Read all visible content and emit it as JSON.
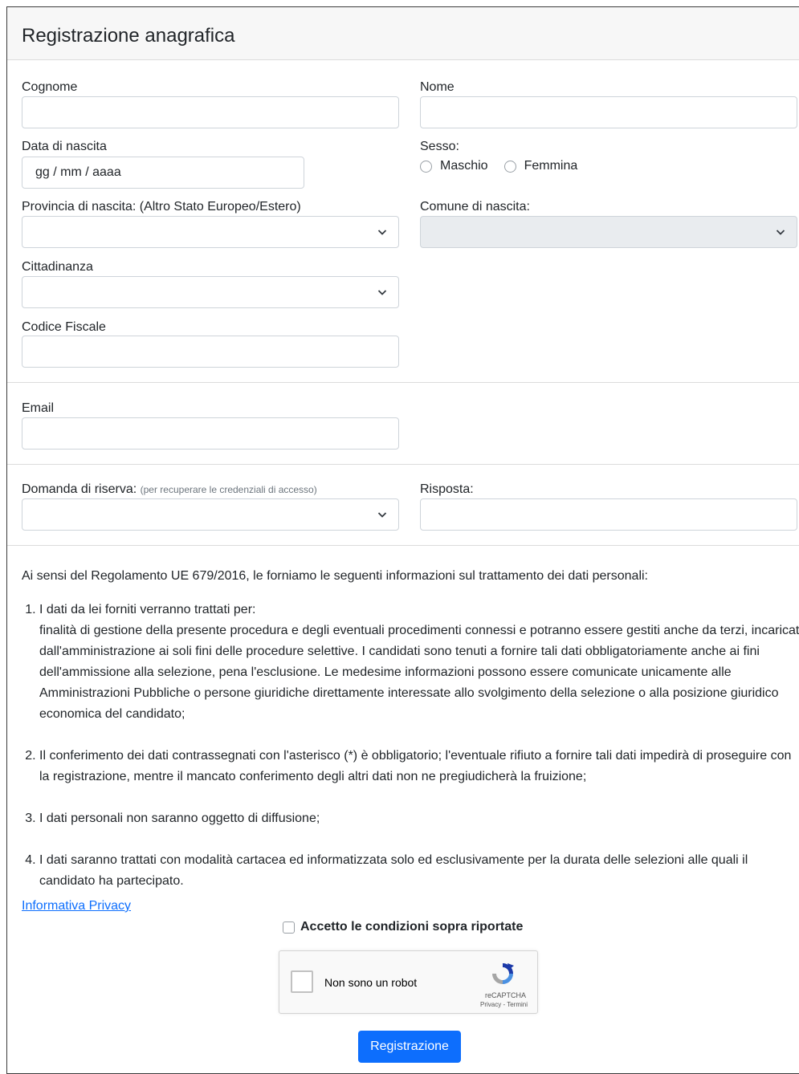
{
  "header": {
    "title": "Registrazione anagrafica"
  },
  "fields": {
    "cognome": {
      "label": "Cognome",
      "value": ""
    },
    "nome": {
      "label": "Nome",
      "value": ""
    },
    "data_nascita": {
      "label": "Data di nascita",
      "placeholder": "gg / mm / aaaa"
    },
    "sesso": {
      "label": "Sesso:",
      "options": [
        "Maschio",
        "Femmina"
      ]
    },
    "provincia": {
      "label": "Provincia di nascita: (Altro Stato Europeo/Estero)",
      "value": ""
    },
    "comune": {
      "label": "Comune di nascita:",
      "value": ""
    },
    "cittadinanza": {
      "label": "Cittadinanza",
      "value": ""
    },
    "codice_fiscale": {
      "label": "Codice Fiscale",
      "value": ""
    },
    "email": {
      "label": "Email",
      "value": ""
    },
    "domanda": {
      "label": "Domanda di riserva:",
      "hint": "(per recuperare le credenziali di accesso)",
      "value": ""
    },
    "risposta": {
      "label": "Risposta:",
      "value": ""
    }
  },
  "privacy": {
    "intro": "Ai sensi del Regolamento UE 679/2016, le forniamo le seguenti informazioni sul trattamento dei dati personali:",
    "items": [
      {
        "title": "I dati da lei forniti verranno trattati per:",
        "text": "finalità di gestione della presente procedura e degli eventuali procedimenti connessi e potranno essere gestiti anche da terzi, incaricati dall'amministrazione ai soli fini delle procedure selettive. I candidati sono tenuti a fornire tali dati obbligatoriamente anche ai fini dell'ammissione alla selezione, pena l'esclusione. Le medesime informazioni possono essere comunicate unicamente alle Amministrazioni Pubbliche o persone giuridiche direttamente interessate allo svolgimento della selezione o alla posizione giuridico economica del candidato;"
      },
      {
        "title": "",
        "text": "Il conferimento dei dati contrassegnati con l'asterisco (*) è obbligatorio; l'eventuale rifiuto a fornire tali dati impedirà di proseguire con la registrazione, mentre il mancato conferimento degli altri dati non ne pregiudicherà la fruizione;"
      },
      {
        "title": "",
        "text": "I dati personali non saranno oggetto di diffusione;"
      },
      {
        "title": "",
        "text": "I dati saranno trattati con modalità cartacea ed informatizzata solo ed esclusivamente per la durata delle selezioni alle quali il candidato ha partecipato."
      }
    ],
    "link": "Informativa Privacy",
    "accept_label": "Accetto le condizioni sopra riportate"
  },
  "captcha": {
    "label": "Non sono un robot",
    "brand": "reCAPTCHA",
    "terms": "Privacy - Termini"
  },
  "submit": {
    "label": "Registrazione"
  },
  "colors": {
    "primary": "#0d6efd",
    "border": "#ced4da",
    "disabled": "#e9ecef"
  }
}
